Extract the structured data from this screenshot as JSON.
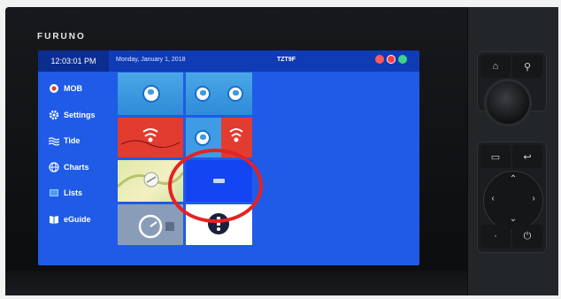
{
  "brand": "FURUNO",
  "status_bar": {
    "time": "12:03:01 PM",
    "date": "Monday, January 1, 2018",
    "model": "TZT9F",
    "icons": [
      "alert-icon",
      "record-icon",
      "gps-icon"
    ]
  },
  "sidebar": {
    "items": [
      {
        "label": "MOB",
        "icon": "mob-icon"
      },
      {
        "label": "Settings",
        "icon": "gear-icon"
      },
      {
        "label": "Tide",
        "icon": "wave-icon"
      },
      {
        "label": "Charts",
        "icon": "globe-icon"
      },
      {
        "label": "Lists",
        "icon": "list-icon"
      },
      {
        "label": "eGuide",
        "icon": "book-icon"
      }
    ]
  },
  "home_tiles": [
    {
      "type": "chart",
      "icon": "globe-icon"
    },
    {
      "type": "chart-chart",
      "icon": "globe-icon"
    },
    {
      "type": "radar",
      "icon": "radar-icon"
    },
    {
      "type": "chart-radar",
      "icon": "globe-icon"
    },
    {
      "type": "aerial-chart",
      "icon": "chart-icon"
    },
    {
      "type": "add-display",
      "icon": "minus-icon"
    },
    {
      "type": "instrument",
      "icon": "gauge-icon"
    },
    {
      "type": "info",
      "icon": "info-icon"
    }
  ],
  "colors": {
    "screen_bg": "#1f5be6",
    "status_bar": "#0f3bb5",
    "radar_tile": "#e23b2f",
    "highlight": "#e52222"
  },
  "hardware_buttons": {
    "top_left": "home-icon",
    "top_right": "waypoint-icon",
    "mid_left": "layers-icon",
    "mid_right": "back-icon",
    "bottom_left": "dot-icon",
    "bottom_right": "power-icon"
  }
}
